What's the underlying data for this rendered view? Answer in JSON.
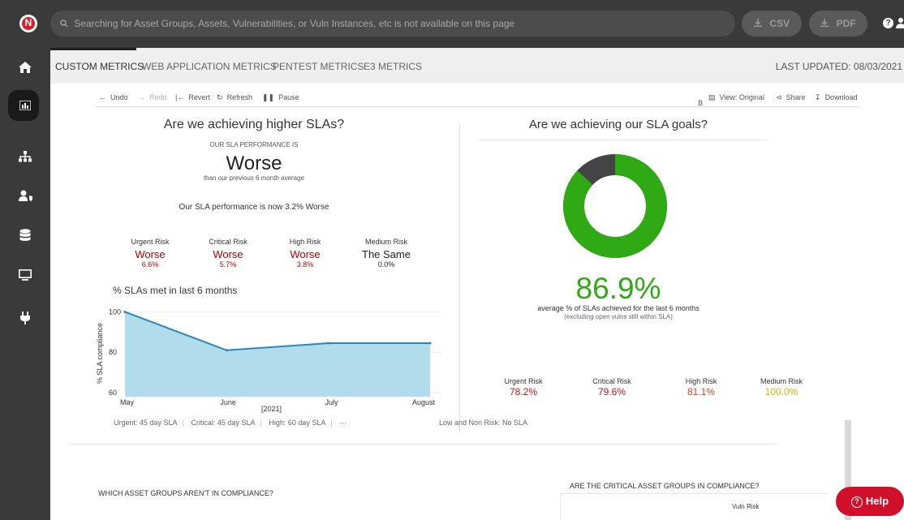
{
  "topbar": {
    "logo_text": "N",
    "search_placeholder": "Searching for Asset Groups, Assets, Vulnerabilities, or Vuln Instances, etc is not available on this page",
    "csv_label": "CSV",
    "pdf_label": "PDF",
    "help_glyph": "?"
  },
  "sidebar": {
    "items": [
      {
        "icon": "home-icon"
      },
      {
        "icon": "dashboard-chart-icon",
        "active": true
      },
      {
        "icon": "sitemap-icon"
      },
      {
        "icon": "user-shield-icon"
      },
      {
        "icon": "database-icon"
      },
      {
        "icon": "monitor-icon"
      },
      {
        "icon": "plug-icon"
      }
    ]
  },
  "tabs": [
    {
      "label": "CUSTOM METRICS",
      "active": true
    },
    {
      "label": "WEB APPLICATION METRICS"
    },
    {
      "label": "PENTEST METRICS"
    },
    {
      "label": "E3 METRICS"
    }
  ],
  "last_updated": "LAST UPDATED: 08/03/2021",
  "toolbar": {
    "undo": "Undo",
    "redo": "Redo",
    "revert": "Revert",
    "refresh": "Refresh",
    "pause": "Pause",
    "b_marker": "B",
    "view": "View: Original",
    "share": "Share",
    "download": "Download"
  },
  "left_panel": {
    "title": "Are we achieving higher SLAs?",
    "subtitle": "OUR SLA PERFORMANCE IS",
    "status": "Worse",
    "status_note": "than our previous 6 month average",
    "summary": "Our SLA performance is now 3.2% Worse",
    "risks": [
      {
        "label": "Urgent Risk",
        "status": "Worse",
        "pct": "6.6%"
      },
      {
        "label": "Critical Risk",
        "status": "Worse",
        "pct": "5.7%"
      },
      {
        "label": "High Risk",
        "status": "Worse",
        "pct": "3.8%"
      },
      {
        "label": "Medium Risk",
        "status": "The Same",
        "pct": "0.0%"
      }
    ],
    "chart_title": "% SLAs met in last 6 months"
  },
  "chart_data": {
    "type": "area",
    "categories": [
      "May",
      "June",
      "July",
      "August"
    ],
    "values": [
      100,
      81,
      84.5,
      84.5
    ],
    "xlabel": "[2021]",
    "ylabel": "% SLA compliance",
    "yticks": [
      60,
      80,
      100
    ],
    "ylim": [
      58,
      103
    ],
    "colors": {
      "fill": "#a9d8ea",
      "line": "#2b87b8"
    }
  },
  "sla_row": {
    "urgent": "Urgent: 45 day SLA",
    "critical": "Critical: 45 day SLA",
    "high": "High: 60 day SLA",
    "more": "···",
    "low": "Low and Non Risk: No SLA"
  },
  "right_panel": {
    "title": "Are we achieving our SLA goals?",
    "donut": {
      "achieved": 86.9,
      "achieved_color": "#2faa14",
      "missed_color": "#444444"
    },
    "big_pct": "86.9%",
    "avg_line1": "average % of SLAs achieved for the last 6 months",
    "avg_line2": "(excluding open vulns still within SLA)",
    "risks": [
      {
        "label": "Urgent Risk",
        "value": "78.2%",
        "color": "#c0111b"
      },
      {
        "label": "Critical Risk",
        "value": "79.6%",
        "color": "#c0111b"
      },
      {
        "label": "High Risk",
        "value": "81.1%",
        "color": "#d9411a"
      },
      {
        "label": "Medium Risk",
        "value": "100.0%",
        "color": "#e8a900"
      }
    ]
  },
  "bottom": {
    "q1": "WHICH ASSET GROUPS AREN'T IN COMPLIANCE?",
    "q2": "ARE THE CRITICAL ASSET GROUPS IN COMPLIANCE?",
    "vuln_risk": "Vuln Risk"
  },
  "help_button": "Help"
}
